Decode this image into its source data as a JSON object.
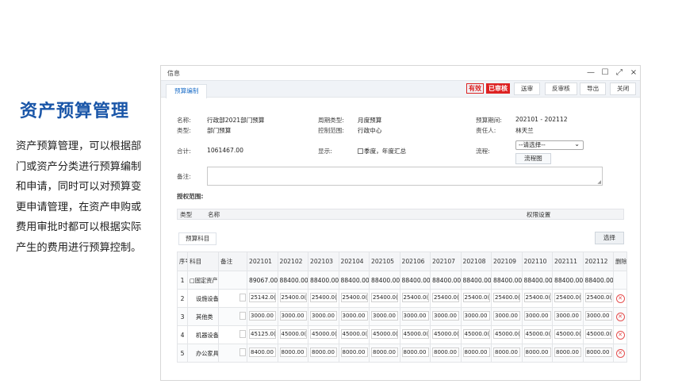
{
  "slide": {
    "title": "资产预算管理",
    "description": "资产预算管理，可以根据部门或资产分类进行预算编制和申请，同时可以对预算变更申请管理，在资产申购或费用审批时都可以根据实际产生的费用进行预算控制。"
  },
  "window": {
    "title": "信息",
    "controls": [
      "—",
      "☐",
      "⤢",
      "×"
    ]
  },
  "tabbar": {
    "active_tab": "预算编制",
    "stamps": {
      "valid": "有效",
      "audited": "已审核"
    },
    "buttons": {
      "submit": "送审",
      "unapprove": "反审核",
      "export": "导出",
      "close": "关闭"
    }
  },
  "form": {
    "name_label": "名称:",
    "name_value": "行政部2021部门预算",
    "type_label": "类型:",
    "type_value": "部门预算",
    "total_label": "合计:",
    "total_value": "1061467.00",
    "period_type_label": "周期类型:",
    "period_type_value": "月度预算",
    "control_label": "控制范围:",
    "control_value": "行政中心",
    "display_label": "显示:",
    "display_value": "季度，年度汇总",
    "budget_period_label": "预算期间:",
    "budget_period_value": "202101 - 202112",
    "owner_label": "责任人:",
    "owner_value": "林天兰",
    "flow_label": "流程:",
    "flow_select": "--请选择--",
    "flow_chart_button": "流程图",
    "remark_label": "备注:"
  },
  "scope": {
    "label": "授权范围:",
    "headers": {
      "type": "类型",
      "name": "名称",
      "permission": "权限设置"
    }
  },
  "budget": {
    "subtab": "预算科目",
    "select_button": "选择",
    "headers": {
      "seq": "序号",
      "item": "科目",
      "remark": "备注",
      "delete": "删除"
    },
    "months": [
      "202101",
      "202102",
      "202103",
      "202104",
      "202105",
      "202106",
      "202107",
      "202108",
      "202109",
      "202110",
      "202111",
      "202112"
    ],
    "rows": [
      {
        "seq": "1",
        "item": "□固定资产",
        "values": [
          "89067.00",
          "88400.00",
          "88400.00",
          "88400.00",
          "88400.00",
          "88400.00",
          "88400.00",
          "88400.00",
          "88400.00",
          "88400.00",
          "88400.00",
          "88400.00"
        ]
      },
      {
        "seq": "2",
        "item": "设施设备",
        "values": [
          "25142.0(",
          "25400.0(",
          "25400.0(",
          "25400.0(",
          "25400.0(",
          "25400.0(",
          "25400.0(",
          "25400.0(",
          "25400.0(",
          "25400.0(",
          "25400.0(",
          "25400.0("
        ]
      },
      {
        "seq": "3",
        "item": "其他类",
        "values": [
          "3000.00",
          "3000.00",
          "3000.00",
          "3000.00",
          "3000.00",
          "3000.00",
          "3000.00",
          "3000.00",
          "3000.00",
          "3000.00",
          "3000.00",
          "3000.00"
        ]
      },
      {
        "seq": "4",
        "item": "机器设备",
        "values": [
          "45125.0(",
          "45000.0(",
          "45000.0(",
          "45000.0(",
          "45000.0(",
          "45000.0(",
          "45000.0(",
          "45000.0(",
          "45000.0(",
          "45000.0(",
          "45000.0(",
          "45000.0("
        ]
      },
      {
        "seq": "5",
        "item": "办公家具",
        "values": [
          "8400.00",
          "8000.00",
          "8000.00",
          "8000.00",
          "8000.00",
          "8000.00",
          "8000.00",
          "8000.00",
          "8000.00",
          "8000.00",
          "8000.00",
          "8000.00"
        ]
      }
    ]
  }
}
